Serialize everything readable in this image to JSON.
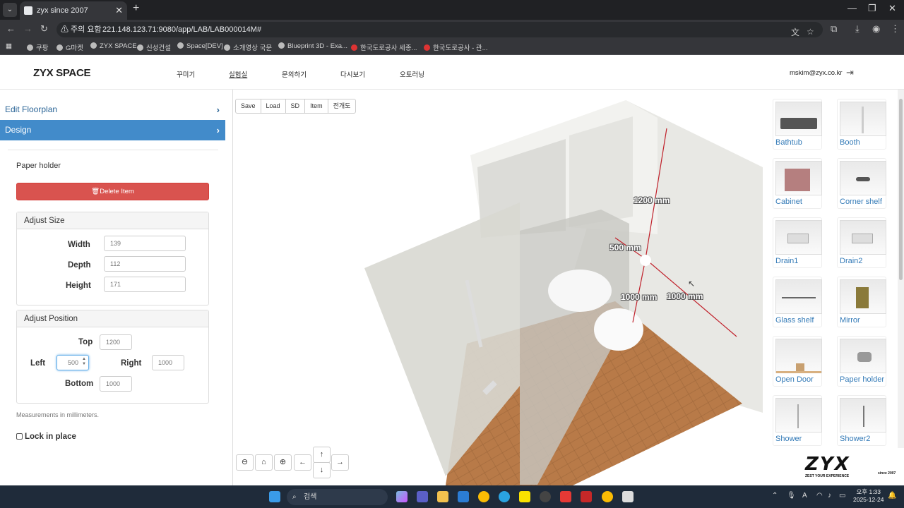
{
  "browser": {
    "tab_title": "zyx since 2007",
    "new_tab": "+",
    "tab_close": "✕",
    "security_warning": "⚠ 주의 요함",
    "url": "221.148.123.71:9080/app/LAB/LAB000014M#",
    "bookmarks": [
      "쿠팡",
      "G마켓",
      "ZYX SPACE",
      "신성건설",
      "Space[DEV]",
      "소개영상 국문",
      "Blueprint 3D - Exa...",
      "한국도로공사 세종...",
      "한국도로공사 - 관..."
    ]
  },
  "header": {
    "brand": "ZYX SPACE",
    "menu": [
      "꾸미기",
      "실험실",
      "문의하기",
      "다시보기",
      "오토러닝"
    ],
    "user_email": "mskim@zyx.co.kr"
  },
  "sidebar": {
    "edit_floorplan": "Edit Floorplan",
    "design": "Design",
    "item_name": "Paper holder",
    "delete_label": "🗑Delete Item",
    "adjust_size": {
      "title": "Adjust Size",
      "width_label": "Width",
      "width_value": "139",
      "depth_label": "Depth",
      "depth_value": "112",
      "height_label": "Height",
      "height_value": "171"
    },
    "adjust_position": {
      "title": "Adjust Position",
      "top_label": "Top",
      "top_value": "1200",
      "left_label": "Left",
      "left_value": "500",
      "right_label": "Right",
      "right_value": "1000",
      "bottom_label": "Bottom",
      "bottom_value": "1000"
    },
    "note": "Measurements in millimeters.",
    "lock_label": "Lock in place"
  },
  "viewport": {
    "toolbar": [
      "Save",
      "Load",
      "SD",
      "Item",
      "전개도"
    ],
    "dimensions": [
      "1200 mm",
      "500 mm",
      "1000 mm",
      "1000 mm"
    ],
    "controls": [
      "zoom-out",
      "home",
      "zoom-in",
      "left",
      "up",
      "down",
      "right"
    ]
  },
  "catalog": {
    "items": [
      "Bathtub",
      "Booth",
      "Cabinet",
      "Corner shelf",
      "Drain1",
      "Drain2",
      "Glass shelf",
      "Mirror",
      "Open Door",
      "Paper holder",
      "Shower",
      "Shower2"
    ]
  },
  "logo": {
    "main": "ZYX",
    "tagline": "ZEST YOUR EXPERIENCE",
    "since": "since 2007"
  },
  "taskbar": {
    "search_placeholder": "검색",
    "time": "오후 1:33",
    "date": "2025-12-24"
  },
  "colors": {
    "primary": "#428bca",
    "danger": "#d9534f",
    "link": "#337ab7",
    "dim_line": "#c0202a"
  }
}
